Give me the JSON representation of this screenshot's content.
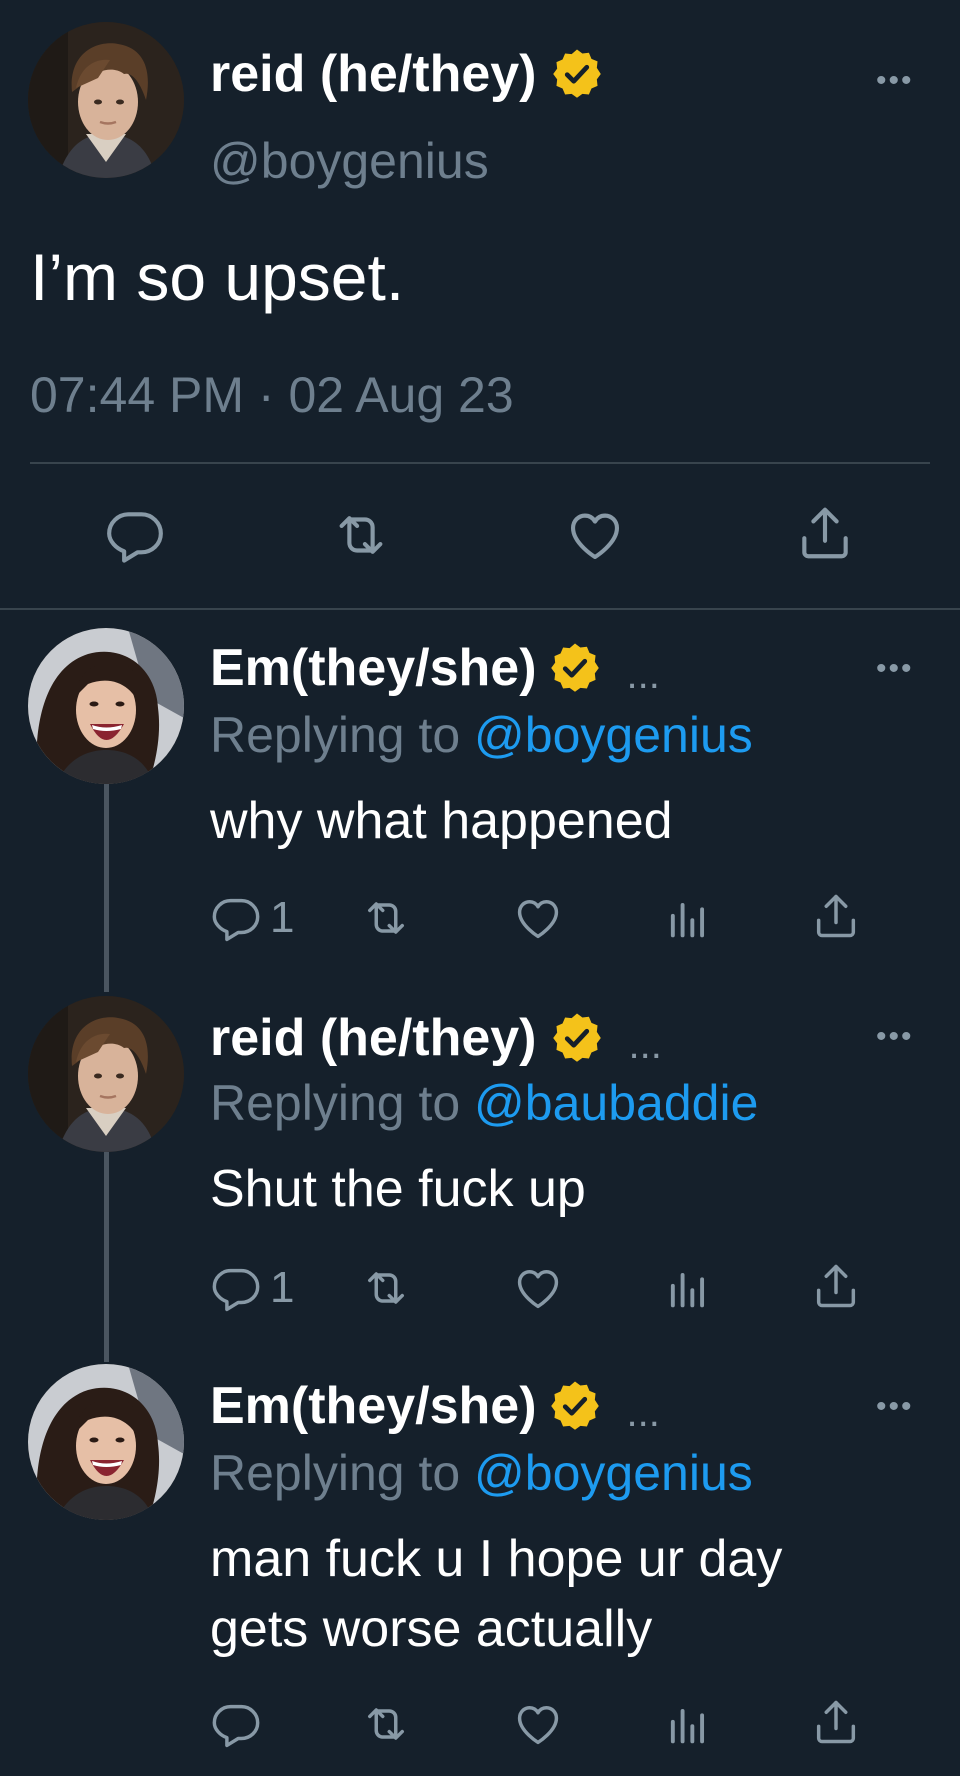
{
  "main_tweet": {
    "name": "reid (he/they)",
    "handle": "@boygenius",
    "text": "I’m so upset.",
    "timestamp": "07:44 PM · 02 Aug 23",
    "more_label": "•••"
  },
  "replies": [
    {
      "name": "Em(they/she)",
      "replying_prefix": "Replying to ",
      "replying_to": "@boygenius",
      "text_lines": [
        "why what happened"
      ],
      "reply_count": "1",
      "more_label": "•••",
      "ellipsis": "..."
    },
    {
      "name": "reid (he/they)",
      "replying_prefix": "Replying to ",
      "replying_to": "@baubaddie",
      "text_lines": [
        "Shut the fuck up"
      ],
      "reply_count": "1",
      "more_label": "•••",
      "ellipsis": "..."
    },
    {
      "name": "Em(they/she)",
      "replying_prefix": "Replying to ",
      "replying_to": "@boygenius",
      "text_lines": [
        "man fuck u I hope ur day",
        "gets worse actually"
      ],
      "reply_count": "",
      "more_label": "•••",
      "ellipsis": "..."
    }
  ],
  "icons": {
    "reply": "reply-icon",
    "retweet": "retweet-icon",
    "like": "heart-icon",
    "views": "views-icon",
    "share": "share-icon",
    "verified": "verified-badge-icon"
  },
  "colors": {
    "background": "#15202b",
    "text": "#ffffff",
    "muted": "#6e7f8e",
    "link": "#1d9bf0",
    "badge": "#f4c21a",
    "divider": "#38444d"
  }
}
